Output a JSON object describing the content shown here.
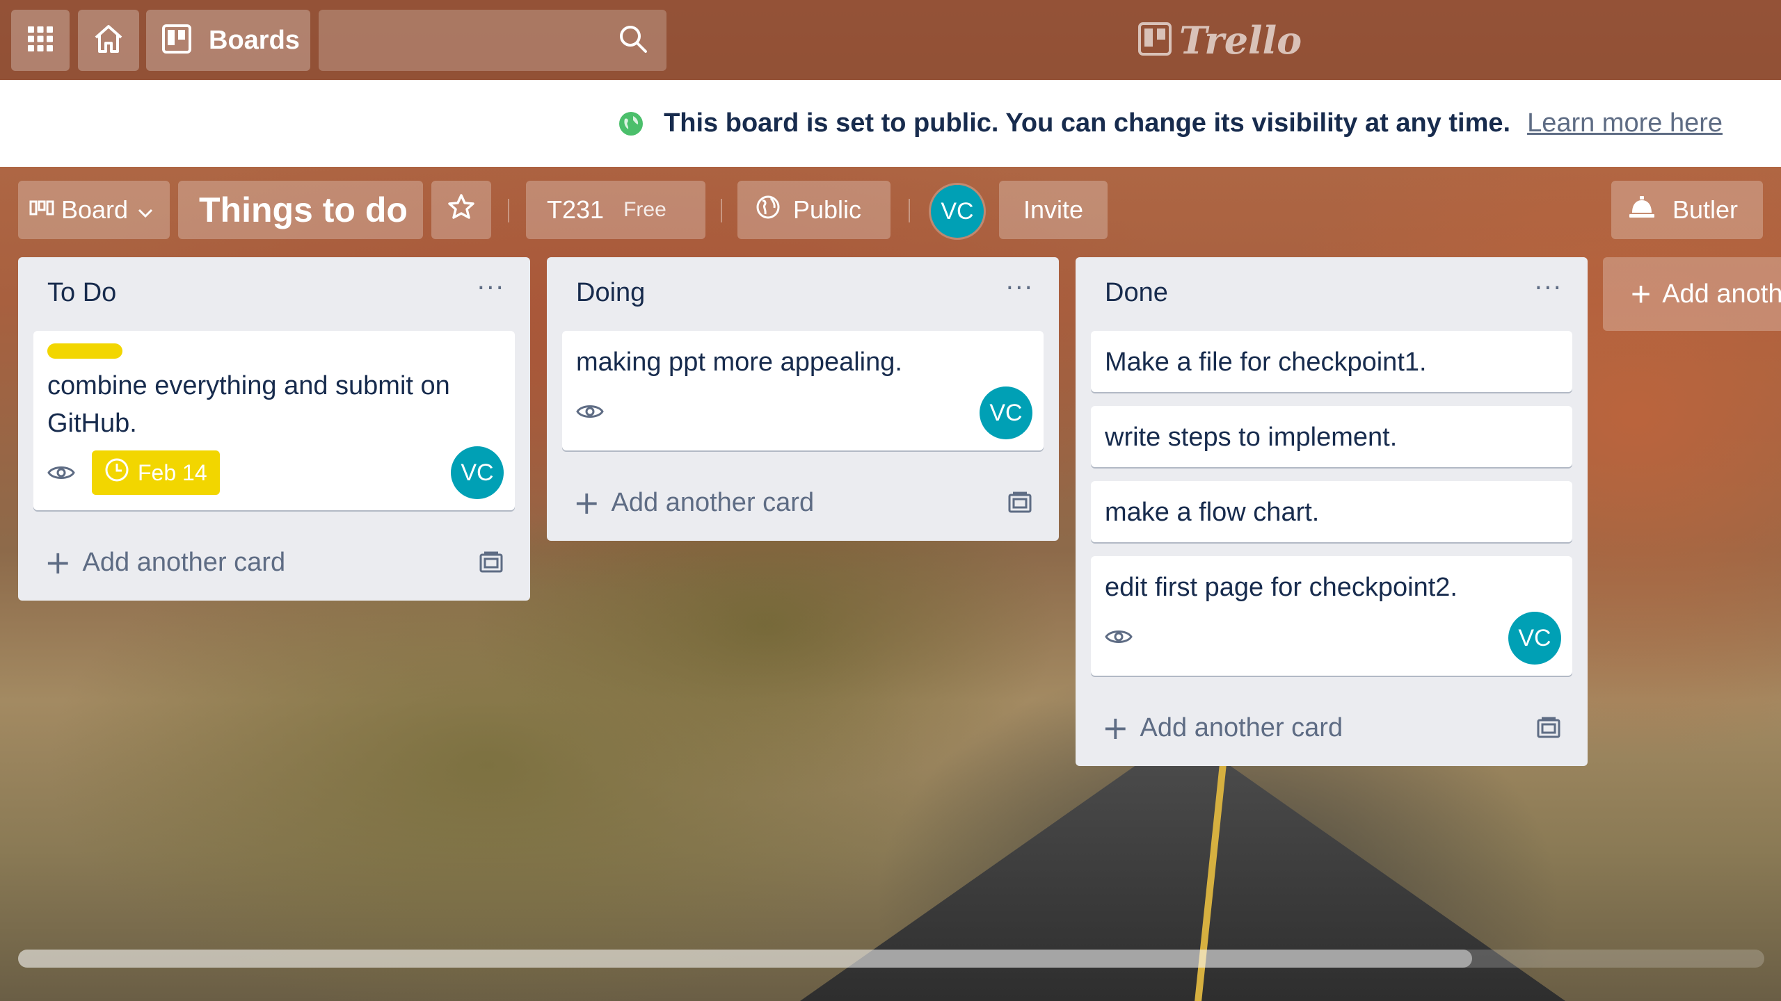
{
  "topbar": {
    "boards_label": "Boards",
    "logo_text": "Trello",
    "icons": [
      "apps-grid-icon",
      "home-icon",
      "boards-icon",
      "search-icon"
    ]
  },
  "notice": {
    "message": "This board is set to public. You can change its visibility at any time.",
    "link": "Learn more here",
    "icon": "globe-icon",
    "icon_color": "#4bbf6b"
  },
  "board_header": {
    "view_label": "Board",
    "title": "Things to do",
    "team": "T231",
    "plan": "Free",
    "visibility": "Public",
    "member_initials": "VC",
    "invite_label": "Invite",
    "butler_label": "Butler"
  },
  "lists": [
    {
      "title": "To Do",
      "menu": "···",
      "cards": [
        {
          "text": "combine everything and submit on GitHub.",
          "label_color": "#f2d600",
          "due": "Feb 14",
          "member": "VC",
          "watched": true
        }
      ],
      "add_card_label": "Add another card"
    },
    {
      "title": "Doing",
      "menu": "···",
      "cards": [
        {
          "text": "making ppt more appealing.",
          "member": "VC",
          "watched": true
        }
      ],
      "add_card_label": "Add another card"
    },
    {
      "title": "Done",
      "menu": "···",
      "cards": [
        {
          "text": "Make a file for checkpoint1."
        },
        {
          "text": "write steps to implement."
        },
        {
          "text": "make a flow chart."
        },
        {
          "text": "edit first page for checkpoint2.",
          "member": "VC",
          "watched": true
        }
      ],
      "add_card_label": "Add another card"
    }
  ],
  "add_list_label": "Add another list",
  "colors": {
    "avatar": "#00a0b5",
    "due_badge": "#f2d600",
    "list_bg": "#ebecf0",
    "text": "#172b4d"
  }
}
